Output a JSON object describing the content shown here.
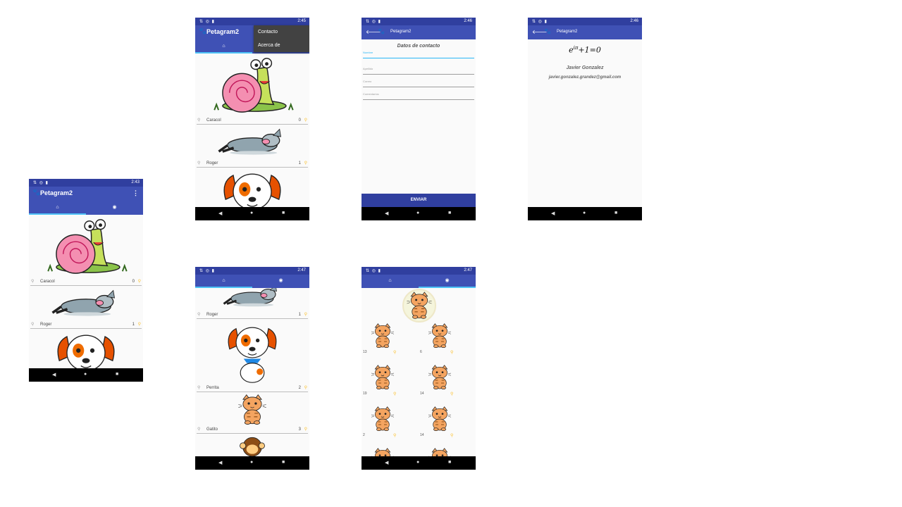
{
  "app": {
    "title": "Petagram2"
  },
  "tabs": {
    "home_icon": "⌂",
    "profile_icon": "◉"
  },
  "nav": {
    "back": "◀",
    "home": "●",
    "recents": "■"
  },
  "icons": {
    "bone": "⚲",
    "yellow_bone": "⚲",
    "paw": "🐾",
    "back_arrow": "🡐",
    "overflow": "⋮"
  },
  "screens": [
    {
      "time": "2:43"
    },
    {
      "time": "2:45"
    },
    {
      "time": "2:46"
    },
    {
      "time": "2:46"
    },
    {
      "time": "2:47"
    },
    {
      "time": "2:47"
    }
  ],
  "pets_home": [
    {
      "name": "Caracol",
      "likes": "0"
    },
    {
      "name": "Roger",
      "likes": "1"
    }
  ],
  "pets_scroll": [
    {
      "name": "Roger",
      "likes": "1"
    },
    {
      "name": "Perrita",
      "likes": "2"
    },
    {
      "name": "Gatito",
      "likes": "3"
    }
  ],
  "menu": {
    "item1": "Contacto",
    "item2": "Acerca de"
  },
  "contact": {
    "heading": "Datos de contacto",
    "field1": "Nombre",
    "field2": "Apellido",
    "field3": "Correo",
    "field4": "Comentarios",
    "send": "ENVIAR"
  },
  "about": {
    "formula_base": "e",
    "formula_exp": "iπ",
    "formula_rest": "+1=0",
    "name": "Javier Gonzalez",
    "email": "javier.gonzalez.grandez@gmail.com"
  },
  "profile_grid": [
    {
      "count": "13"
    },
    {
      "count": "6"
    },
    {
      "count": "19"
    },
    {
      "count": "14"
    },
    {
      "count": "2"
    },
    {
      "count": "14"
    }
  ],
  "colors": {
    "primary": "#3f51b5",
    "primary_dark": "#303f9f",
    "accent": "#4fc3f7",
    "bone_yellow": "#fbc02d"
  }
}
